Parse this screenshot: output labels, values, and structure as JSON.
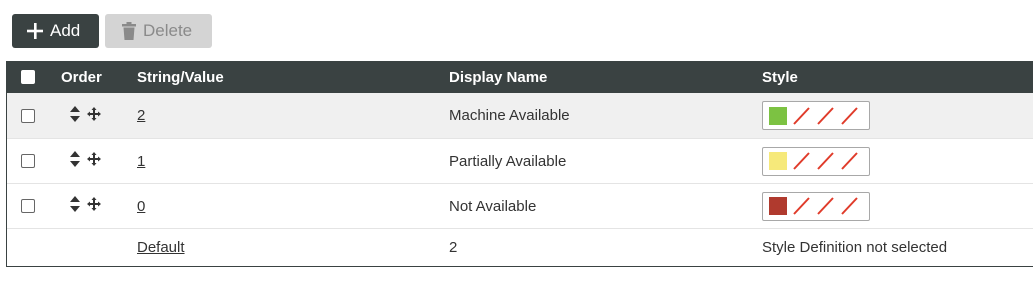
{
  "toolbar": {
    "add_label": "Add",
    "delete_label": "Delete"
  },
  "table": {
    "headers": {
      "order": "Order",
      "string_value": "String/Value",
      "display_name": "Display Name",
      "style": "Style"
    },
    "rows": [
      {
        "value": "2",
        "display_name": "Machine Available",
        "color": "#7cc242"
      },
      {
        "value": "1",
        "display_name": "Partially Available",
        "color": "#f6e97a"
      },
      {
        "value": "0",
        "display_name": "Not Available",
        "color": "#b03a2e"
      }
    ],
    "default_row": {
      "value": "Default",
      "display_name": "2",
      "style": "Style Definition not selected"
    }
  },
  "colors": {
    "header_bg": "#3a4242",
    "no_style_slash": "#e03b2a"
  }
}
